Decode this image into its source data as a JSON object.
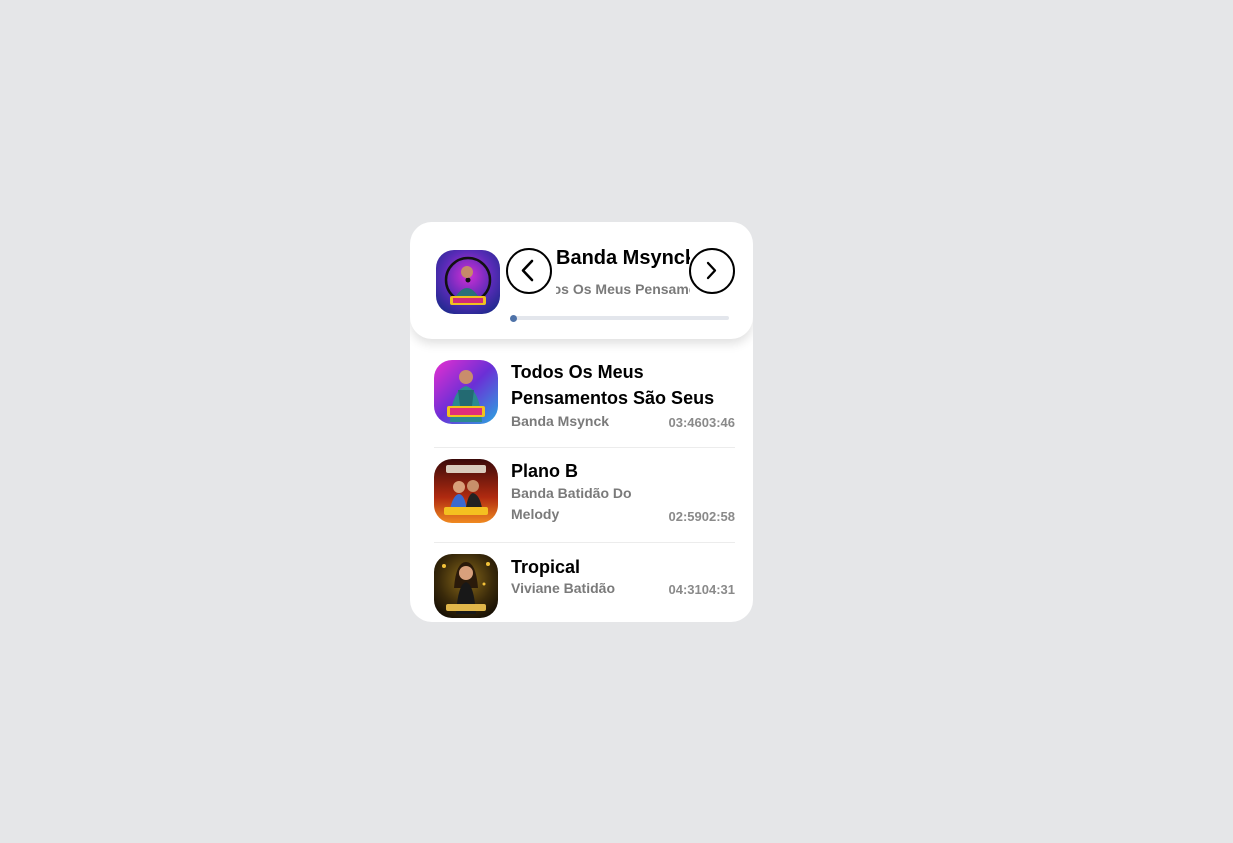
{
  "now_playing": {
    "artist": "Banda Msynck",
    "track": "Todos Os Meus Pensamentos São Seus",
    "cover_icon": "album-cover-msynck",
    "progress": 0.01,
    "prev_icon": "chevron-left-icon",
    "next_icon": "chevron-right-icon"
  },
  "colors": {
    "accent": "#5b7fb3",
    "background": "#e5e6e8",
    "card": "#ffffff",
    "muted_text": "#7a7a7a"
  },
  "playlist": [
    {
      "title": "Todos Os Meus Pensamentos São Seus",
      "artist": "Banda Msynck",
      "current_time": "03:46",
      "duration": "03:46",
      "cover_icon": "album-cover-msynck"
    },
    {
      "title": "Plano B",
      "artist": "Banda Batidão Do Melody",
      "current_time": "02:59",
      "duration": "02:58",
      "cover_icon": "album-cover-batidao"
    },
    {
      "title": "Tropical",
      "artist": "Viviane Batidão",
      "current_time": "04:31",
      "duration": "04:31",
      "cover_icon": "album-cover-viviane"
    }
  ]
}
